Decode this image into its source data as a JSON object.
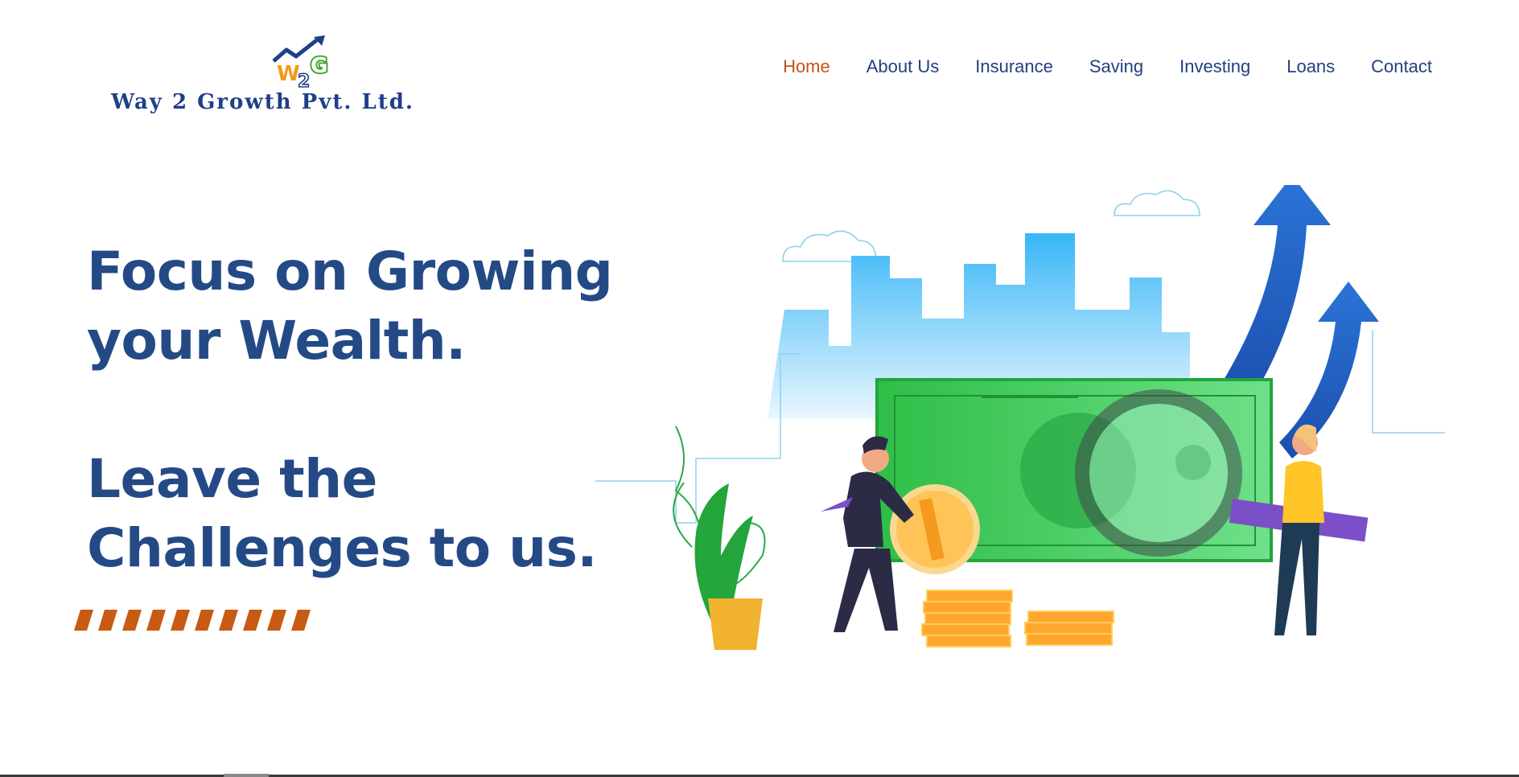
{
  "brand": {
    "name": "Way 2 Growth Pvt. Ltd.",
    "mark_text": "2",
    "colors": {
      "navy": "#1f3f88",
      "orange": "#f29a1f",
      "green": "#49a636"
    }
  },
  "nav": {
    "items": [
      {
        "label": "Home",
        "active": true
      },
      {
        "label": "About Us",
        "active": false
      },
      {
        "label": "Insurance",
        "active": false
      },
      {
        "label": "Saving",
        "active": false
      },
      {
        "label": "Investing",
        "active": false
      },
      {
        "label": "Loans",
        "active": false
      },
      {
        "label": "Contact",
        "active": false
      }
    ],
    "active_color": "#c4541a",
    "color": "#21407f"
  },
  "hero": {
    "lines": [
      "Focus on Growing",
      "your Wealth.",
      "Leave the",
      "Challenges to us."
    ],
    "color": "#244a86",
    "accent_color": "#c85a12"
  },
  "illustration": {
    "icon": "finance-growth-illustration"
  }
}
